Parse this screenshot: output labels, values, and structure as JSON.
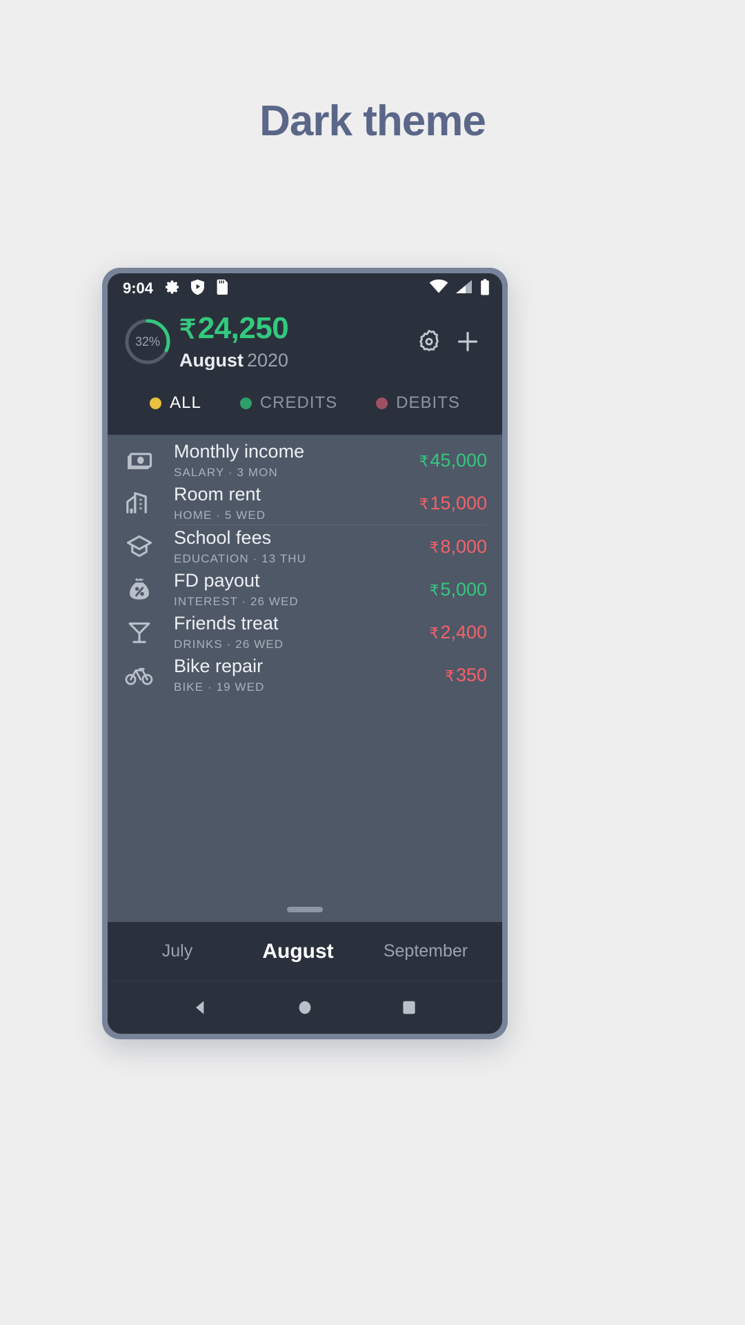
{
  "page": {
    "title": "Dark theme",
    "title_color": "#5b6789",
    "background": "#eeeeee"
  },
  "phone": {
    "bezel_color": "#78839a",
    "screen_bg": "#2b313c"
  },
  "status_bar": {
    "clock": "9:04",
    "left_icons": [
      "gear-icon",
      "shield-play-icon",
      "sd-card-icon"
    ],
    "right_icons": [
      "wifi-icon",
      "cellular-signal-icon",
      "battery-icon"
    ]
  },
  "header": {
    "progress": {
      "percent_label": "32%",
      "percent_value": 32,
      "arc_color": "#33c97e",
      "track_color": "#555c69"
    },
    "amount": {
      "currency": "₹",
      "value": "24,250",
      "color": "#33c97e"
    },
    "period": {
      "month": "August",
      "year": "2020"
    },
    "actions": [
      {
        "name": "settings-button",
        "icon": "gear-icon"
      },
      {
        "name": "add-transaction-button",
        "icon": "plus-icon"
      }
    ]
  },
  "filters": {
    "tabs": [
      {
        "label": "ALL",
        "dot_color": "#e8c13f",
        "active": true
      },
      {
        "label": "CREDITS",
        "dot_color": "#2e9e6b",
        "active": false
      },
      {
        "label": "DEBITS",
        "dot_color": "#9e5160",
        "active": false
      }
    ]
  },
  "transactions": {
    "rows": [
      {
        "icon": "cash-icon",
        "title": "Monthly income",
        "category": "SALARY",
        "date": "3 MON",
        "currency": "₹",
        "amount": "45,000",
        "type": "credit"
      },
      {
        "icon": "house-icon",
        "title": "Room rent",
        "category": "HOME",
        "date": "5 WED",
        "currency": "₹",
        "amount": "15,000",
        "type": "debit"
      },
      {
        "icon": "graduation-icon",
        "title": "School fees",
        "category": "EDUCATION",
        "date": "13 THU",
        "currency": "₹",
        "amount": "8,000",
        "type": "debit"
      },
      {
        "icon": "money-bag-icon",
        "title": "FD payout",
        "category": "INTEREST",
        "date": "26 WED",
        "currency": "₹",
        "amount": "5,000",
        "type": "credit"
      },
      {
        "icon": "cocktail-icon",
        "title": "Friends treat",
        "category": "DRINKS",
        "date": "26 WED",
        "currency": "₹",
        "amount": "2,400",
        "type": "debit"
      },
      {
        "icon": "bicycle-icon",
        "title": "Bike repair",
        "category": "BIKE",
        "date": "19 WED",
        "currency": "₹",
        "amount": "350",
        "type": "debit"
      }
    ],
    "separator": "·",
    "credit_color": "#33c97e",
    "debit_color": "#f4616a",
    "list_bg": "#4e5867"
  },
  "month_selector": {
    "previous": "July",
    "current": "August",
    "next": "September"
  },
  "nav_bar": {
    "buttons": [
      {
        "name": "back-button",
        "icon": "triangle-back-icon"
      },
      {
        "name": "home-button",
        "icon": "circle-home-icon"
      },
      {
        "name": "recents-button",
        "icon": "square-recents-icon"
      }
    ]
  }
}
